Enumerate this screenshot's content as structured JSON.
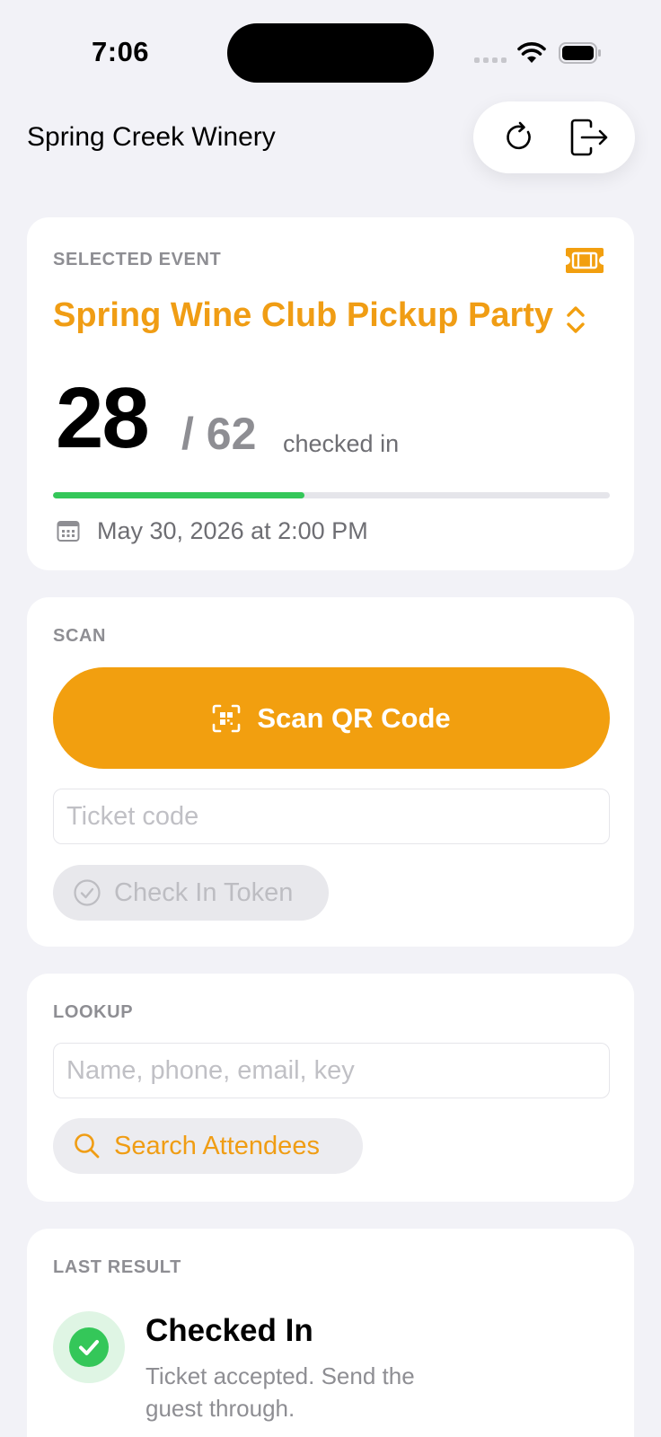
{
  "status_bar": {
    "time": "7:06"
  },
  "header": {
    "title": "Spring Creek Winery",
    "refresh_icon": "refresh-icon",
    "logout_icon": "logout-icon"
  },
  "event": {
    "label": "SELECTED EVENT",
    "name": "Spring Wine Club Pickup Party",
    "checked_in": "28",
    "total": "/ 62",
    "suffix": "checked in",
    "progress_fraction": 0.4516,
    "date": "May 30, 2026 at 2:00 PM",
    "ticket_icon": "ticket-icon",
    "chevron_icon": "chevron-up-down-icon",
    "calendar_icon": "calendar-icon"
  },
  "scan": {
    "label": "SCAN",
    "scan_button": "Scan QR Code",
    "ticket_placeholder": "Ticket code",
    "checkin_button": "Check In Token"
  },
  "lookup": {
    "label": "LOOKUP",
    "search_placeholder": "Name, phone, email, key",
    "search_button": "Search Attendees"
  },
  "last_result": {
    "label": "LAST RESULT",
    "title": "Checked In",
    "message": "Ticket accepted. Send the guest through.",
    "status_color": "#34c759"
  },
  "colors": {
    "accent": "#f29f0f",
    "success": "#34c759",
    "background": "#f2f2f7"
  }
}
